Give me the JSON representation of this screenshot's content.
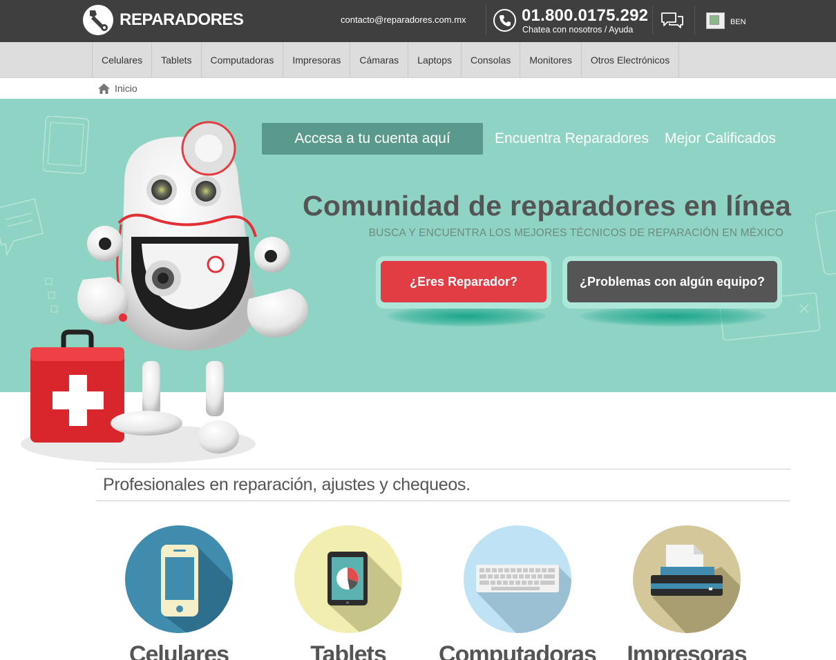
{
  "header": {
    "brand": "REPARADORES",
    "email": "contacto@reparadores.com.mx",
    "phone": "01.800.0175.292",
    "phone_sub": "Chatea con nosotros / Ayuda",
    "language": "BEN",
    "icons": [
      "wrench-logo-icon",
      "phone-icon",
      "chat-icon",
      "flag-icon"
    ]
  },
  "nav": {
    "categories": [
      {
        "label": "Celulares"
      },
      {
        "label": "Tablets"
      },
      {
        "label": "Computadoras"
      },
      {
        "label": "Impresoras"
      },
      {
        "label": "Cámaras"
      },
      {
        "label": "Laptops"
      },
      {
        "label": "Consolas"
      },
      {
        "label": "Monitores"
      },
      {
        "label": "Otros Electrónicos"
      }
    ]
  },
  "breadcrumb": {
    "home_label": "Inicio"
  },
  "hero": {
    "account_link": "Accesa a tu cuenta aquí",
    "find_link": "Encuentra Reparadores",
    "top_rated_link": "Mejor Calificados",
    "title": "Comunidad de reparadores en línea",
    "subtitle": "BUSCA Y ENCUENTRA LOS MEJORES TÉCNICOS DE REPARACIÓN EN MÉXICO",
    "cta_repairer": "¿Eres Reparador?",
    "cta_problems": "¿Problemas con algún equipo?"
  },
  "professionals": {
    "heading": "Profesionales en reparación, ajustes y chequeos.",
    "cards": [
      {
        "label": "Celulares",
        "icon": "phone-device-icon",
        "color": "#3f8cae"
      },
      {
        "label": "Tablets",
        "icon": "tablet-device-icon",
        "color": "#f1eeb0"
      },
      {
        "label": "Computadoras",
        "icon": "keyboard-device-icon",
        "color": "#bfe3f5"
      },
      {
        "label": "Impresoras",
        "icon": "printer-device-icon",
        "color": "#d4c79a"
      }
    ]
  },
  "colors": {
    "topbar": "#3f3f3f",
    "hero": "#8ed3c4",
    "cta_red": "#e23d45",
    "cta_dark": "#555555"
  }
}
